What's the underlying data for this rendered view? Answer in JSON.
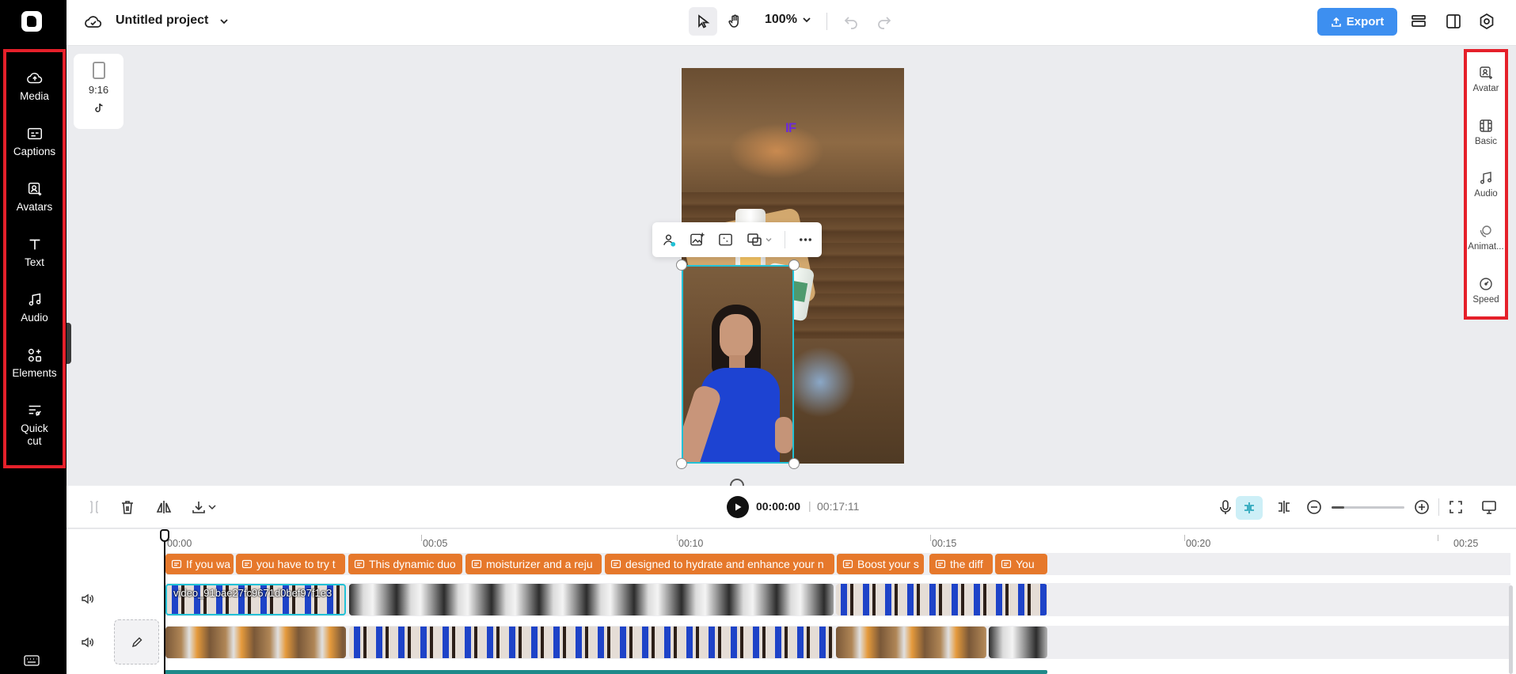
{
  "app": {
    "project_title": "Untitled project"
  },
  "left_rail": {
    "items": [
      {
        "label": "Media",
        "icon": "cloud-upload-icon"
      },
      {
        "label": "Captions",
        "icon": "captions-icon"
      },
      {
        "label": "Avatars",
        "icon": "avatar-icon"
      },
      {
        "label": "Text",
        "icon": "text-icon"
      },
      {
        "label": "Audio",
        "icon": "music-note-icon"
      },
      {
        "label": "Elements",
        "icon": "elements-icon"
      },
      {
        "label": "Quick",
        "label2": "cut",
        "icon": "quick-cut-icon"
      }
    ]
  },
  "topbar": {
    "zoom": "100%",
    "export_label": "Export"
  },
  "format_card": {
    "ratio": "9:16",
    "platform_icon": "tiktok-icon"
  },
  "preview": {
    "watermark": "IF"
  },
  "right_panel": {
    "items": [
      {
        "label": "Avatar",
        "icon": "avatar-add-icon"
      },
      {
        "label": "Basic",
        "icon": "film-icon"
      },
      {
        "label": "Audio",
        "icon": "music-note-icon"
      },
      {
        "label": "Animat...",
        "icon": "animation-icon"
      },
      {
        "label": "Speed",
        "icon": "speed-gauge-icon"
      }
    ]
  },
  "playback": {
    "current_time": "00:00:00",
    "separator": "|",
    "total_time": "00:17:11"
  },
  "timeline": {
    "ruler": [
      "00:00",
      "00:05",
      "00:10",
      "00:15",
      "00:20",
      "00:25"
    ],
    "captions": [
      "If you wa",
      "you have to try t",
      "This dynamic duo",
      "moisturizer and a reju",
      "designed to hydrate and enhance your n",
      "Boost your s",
      "the diff",
      "You"
    ],
    "main_clip_label": "video_91bae27fc9671d0bef97f1e3"
  },
  "colors": {
    "accent": "#3d8ff0",
    "caption": "#e6782b",
    "selection": "#22c1d6",
    "highlight": "#e5202a"
  }
}
